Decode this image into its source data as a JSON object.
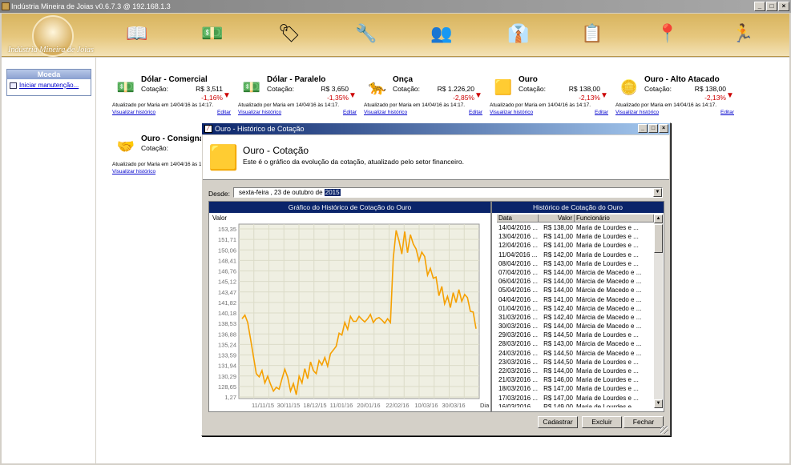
{
  "app": {
    "title": "Indústria Mineira de Joias v0.6.7.3 @ 192.168.1.3",
    "logo_text": "Indústria Mineira de Joias"
  },
  "toolbar_icons": [
    "book-icon",
    "money-icon",
    "tag-icon",
    "tools-icon",
    "people-icon",
    "tie-icon",
    "clipboard-icon",
    "pin-icon",
    "runner-icon"
  ],
  "sidebar": {
    "title": "Moeda",
    "link": "Iniciar manutenção..."
  },
  "cards": [
    {
      "name": "Dólar - Comercial",
      "label": "Cotação:",
      "value": "R$ 3,511",
      "pct": "-1,16%",
      "updated": "Atualizado por Maria em 14/04/16 às 14:17.",
      "history": "Visualizar histórico",
      "edit": "Editar",
      "icon": "dollar-bill-icon"
    },
    {
      "name": "Dólar - Paralelo",
      "label": "Cotação:",
      "value": "R$ 3,650",
      "pct": "-1,35%",
      "updated": "Atualizado por Maria em 14/04/16 às 14:17.",
      "history": "Visualizar histórico",
      "edit": "Editar",
      "icon": "dollar-bill-icon"
    },
    {
      "name": "Onça",
      "label": "Cotação:",
      "value": "R$ 1.226,20",
      "pct": "-2,85%",
      "updated": "Atualizado por Maria em 14/04/16 às 14:17.",
      "history": "Visualizar histórico",
      "edit": "Editar",
      "icon": "jaguar-icon"
    },
    {
      "name": "Ouro",
      "label": "Cotação:",
      "value": "R$ 138,00",
      "pct": "-2,13%",
      "updated": "Atualizado por Maria em 14/04/16 às 14:17.",
      "history": "Visualizar histórico",
      "edit": "Editar",
      "icon": "gold-bars-icon"
    },
    {
      "name": "Ouro - Alto Atacado",
      "label": "Cotação:",
      "value": "R$ 138,00",
      "pct": "-2,13%",
      "updated": "Atualizado por Maria em 14/04/16 às 14:17.",
      "history": "Visualizar histórico",
      "edit": "Editar",
      "icon": "gold-coins-icon"
    },
    {
      "name": "Ouro - Consigna",
      "label": "Cotação:",
      "value": "R$",
      "pct": "-2,",
      "updated": "Atualizado por Maria em 14/04/16 às 14:17.",
      "history": "Visualizar histórico",
      "edit": "",
      "icon": "handshake-icon"
    }
  ],
  "dialog": {
    "title": "Ouro - Histórico de Cotação",
    "header_title": "Ouro - Cotação",
    "header_sub": "Este é o gráfico da evolução da cotação, atualizado pelo setor financeiro.",
    "since_label": "Desde:",
    "since_value": "sexta-feira , 23 de  outubro  de",
    "since_year": "2015",
    "chart_panel_title": "Gráfico do Histórico de Cotação do Ouro",
    "table_panel_title": "Histórico de Cotação do Ouro",
    "table_headers": [
      "Data",
      "Valor",
      "Funcionário"
    ],
    "buttons": {
      "add": "Cadastrar",
      "delete": "Excluir",
      "close": "Fechar"
    }
  },
  "table_rows": [
    [
      "14/04/2016 ...",
      "R$ 138,00",
      "Maria de Lourdes e ..."
    ],
    [
      "13/04/2016 ...",
      "R$ 141,00",
      "Maria de Lourdes e ..."
    ],
    [
      "12/04/2016 ...",
      "R$ 141,00",
      "Maria de Lourdes e ..."
    ],
    [
      "11/04/2016 ...",
      "R$ 142,00",
      "Maria de Lourdes e ..."
    ],
    [
      "08/04/2016 ...",
      "R$ 143,00",
      "Maria de Lourdes e ..."
    ],
    [
      "07/04/2016 ...",
      "R$ 144,00",
      "Márcia de Macedo e ..."
    ],
    [
      "06/04/2016 ...",
      "R$ 144,00",
      "Márcia de Macedo e ..."
    ],
    [
      "05/04/2016 ...",
      "R$ 144,00",
      "Márcia de Macedo e ..."
    ],
    [
      "04/04/2016 ...",
      "R$ 141,00",
      "Márcia de Macedo e ..."
    ],
    [
      "01/04/2016 ...",
      "R$ 142,40",
      "Márcia de Macedo e ..."
    ],
    [
      "31/03/2016 ...",
      "R$ 142,40",
      "Márcia de Macedo e ..."
    ],
    [
      "30/03/2016 ...",
      "R$ 144,00",
      "Márcia de Macedo e ..."
    ],
    [
      "29/03/2016 ...",
      "R$ 144,50",
      "Maria de Lourdes e ..."
    ],
    [
      "28/03/2016 ...",
      "R$ 143,00",
      "Márcia de Macedo e ..."
    ],
    [
      "24/03/2016 ...",
      "R$ 144,50",
      "Márcia de Macedo e ..."
    ],
    [
      "23/03/2016 ...",
      "R$ 144,50",
      "Maria de Lourdes e ..."
    ],
    [
      "22/03/2016 ...",
      "R$ 144,00",
      "Maria de Lourdes e ..."
    ],
    [
      "21/03/2016 ...",
      "R$ 146,00",
      "Maria de Lourdes e ..."
    ],
    [
      "18/03/2016 ...",
      "R$ 147,00",
      "Maria de Lourdes e ..."
    ],
    [
      "17/03/2016 ...",
      "R$ 147,00",
      "Maria de Lourdes e ..."
    ],
    [
      "16/03/2016 ...",
      "R$ 149,00",
      "Maria de Lourdes e ..."
    ]
  ],
  "chart_data": {
    "type": "line",
    "ylabel": "Valor",
    "xlabel": "Dia",
    "y_ticks": [
      "153,35",
      "151,71",
      "150,06",
      "148,41",
      "146,76",
      "145,12",
      "143,47",
      "141,82",
      "140,18",
      "138,53",
      "136,88",
      "135,24",
      "133,59",
      "131,94",
      "130,29",
      "128,65",
      "1,27"
    ],
    "x_ticks": [
      "11/11/15",
      "30/11/15",
      "18/12/15",
      "11/01/16",
      "20/01/16",
      "22/02/16",
      "10/03/16",
      "30/03/16"
    ],
    "ylim": [
      127,
      155
    ],
    "color": "#f5a000",
    "values": [
      139.8,
      140.4,
      139.2,
      136.5,
      133.8,
      131.0,
      130.5,
      131.5,
      129.5,
      130.6,
      129.3,
      128.2,
      128.8,
      128.5,
      130.2,
      131.7,
      130.4,
      128.2,
      129.4,
      127.6,
      130.6,
      129.5,
      131.8,
      130.2,
      132.9,
      131.5,
      131.0,
      133.1,
      132.4,
      133.6,
      132.2,
      134.2,
      134.8,
      135.4,
      137.5,
      137.2,
      139.2,
      138.1,
      140.2,
      139.4,
      139.4,
      140.2,
      139.7,
      139.3,
      139.8,
      140.5,
      139.2,
      139.8,
      140.0,
      139.6,
      139.1,
      139.8,
      139.2,
      149.5,
      154.0,
      152.3,
      150.2,
      153.8,
      150.4,
      153.3,
      151.8,
      151.0,
      149.1,
      150.5,
      149.8,
      146.8,
      147.9,
      146.3,
      146.5,
      143.5,
      145.0,
      142.2,
      143.4,
      141.6,
      144.0,
      142.4,
      144.5,
      142.6,
      143.7,
      143.2,
      141.0,
      140.9,
      138.2
    ]
  }
}
